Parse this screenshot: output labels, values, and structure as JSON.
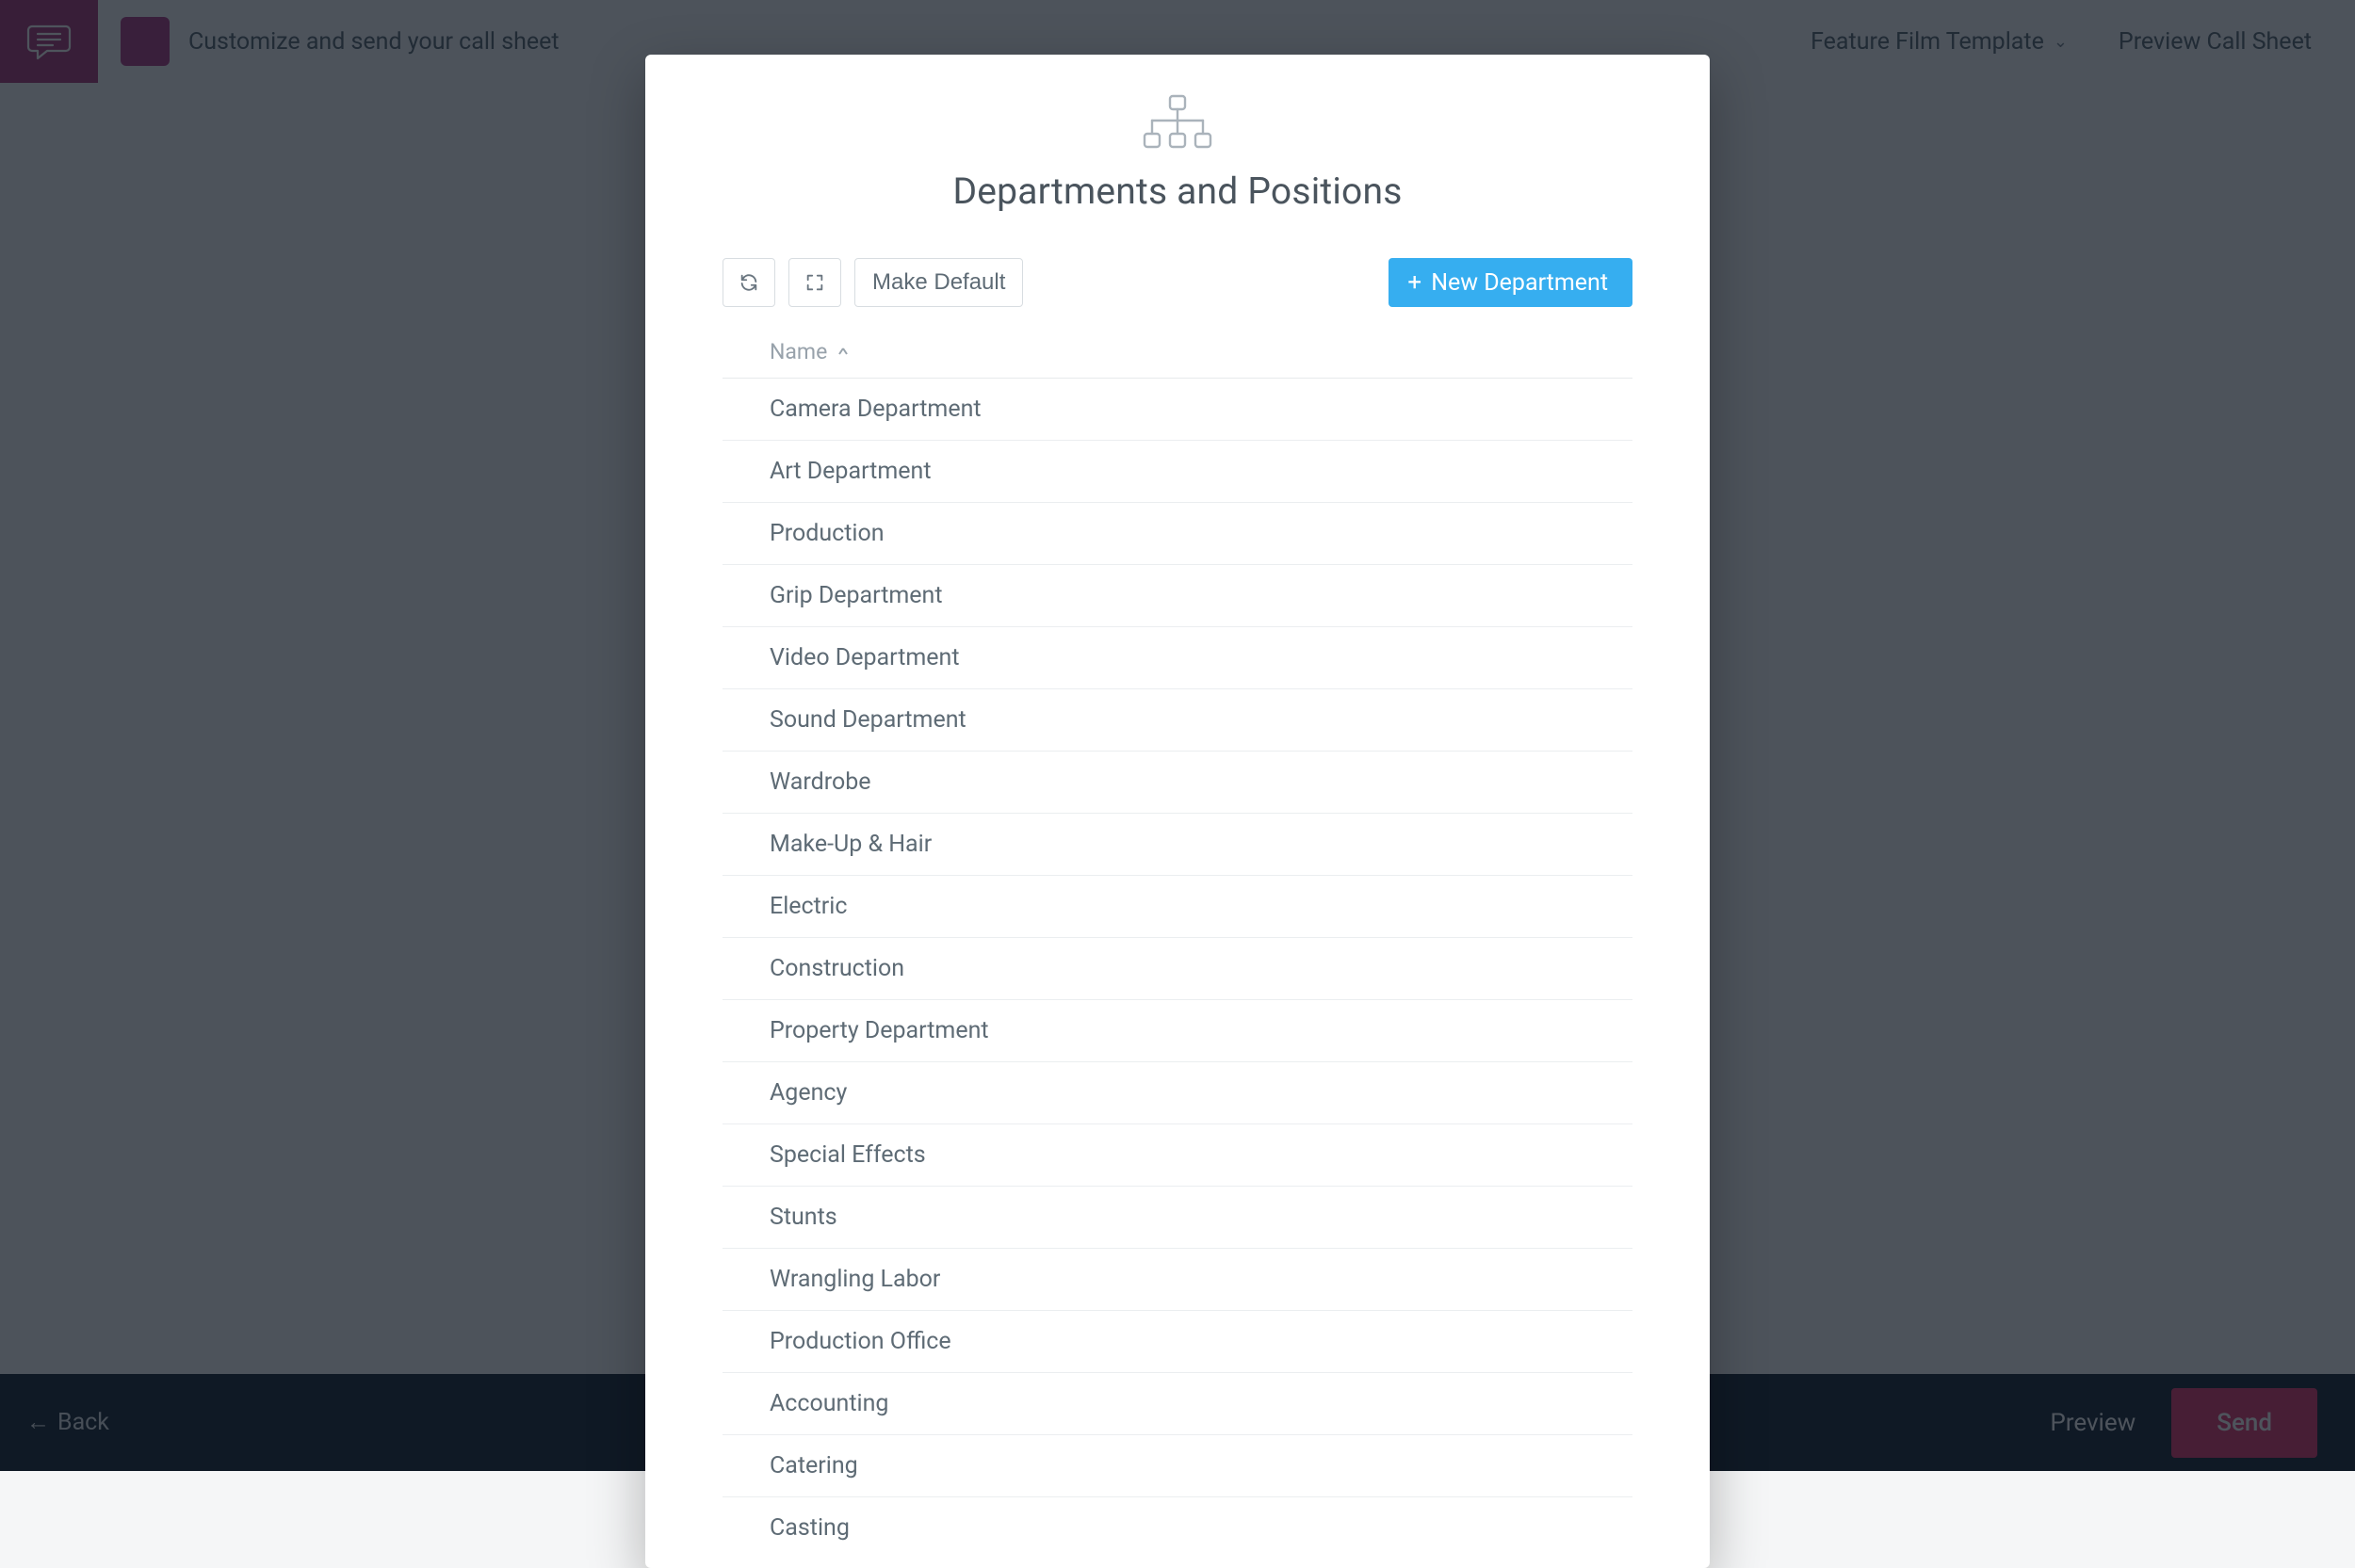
{
  "header": {
    "logo_initials": "",
    "tile_label": "",
    "title": "Customize and send your call sheet",
    "template_label": "Feature Film Template",
    "preview_link": "Preview Call Sheet"
  },
  "footer": {
    "back_label": "Back",
    "preview_label": "Preview",
    "send_label": "Send"
  },
  "modal": {
    "title": "Departments and Positions",
    "toolbar": {
      "make_default_label": "Make Default",
      "new_department_label": "New Department"
    },
    "table": {
      "column_name": "Name",
      "rows": [
        "Camera Department",
        "Art Department",
        "Production",
        "Grip Department",
        "Video Department",
        "Sound Department",
        "Wardrobe",
        "Make-Up & Hair",
        "Electric",
        "Construction",
        "Property Department",
        "Agency",
        "Special Effects",
        "Stunts",
        "Wrangling Labor",
        "Production Office",
        "Accounting",
        "Catering",
        "Casting"
      ]
    }
  }
}
